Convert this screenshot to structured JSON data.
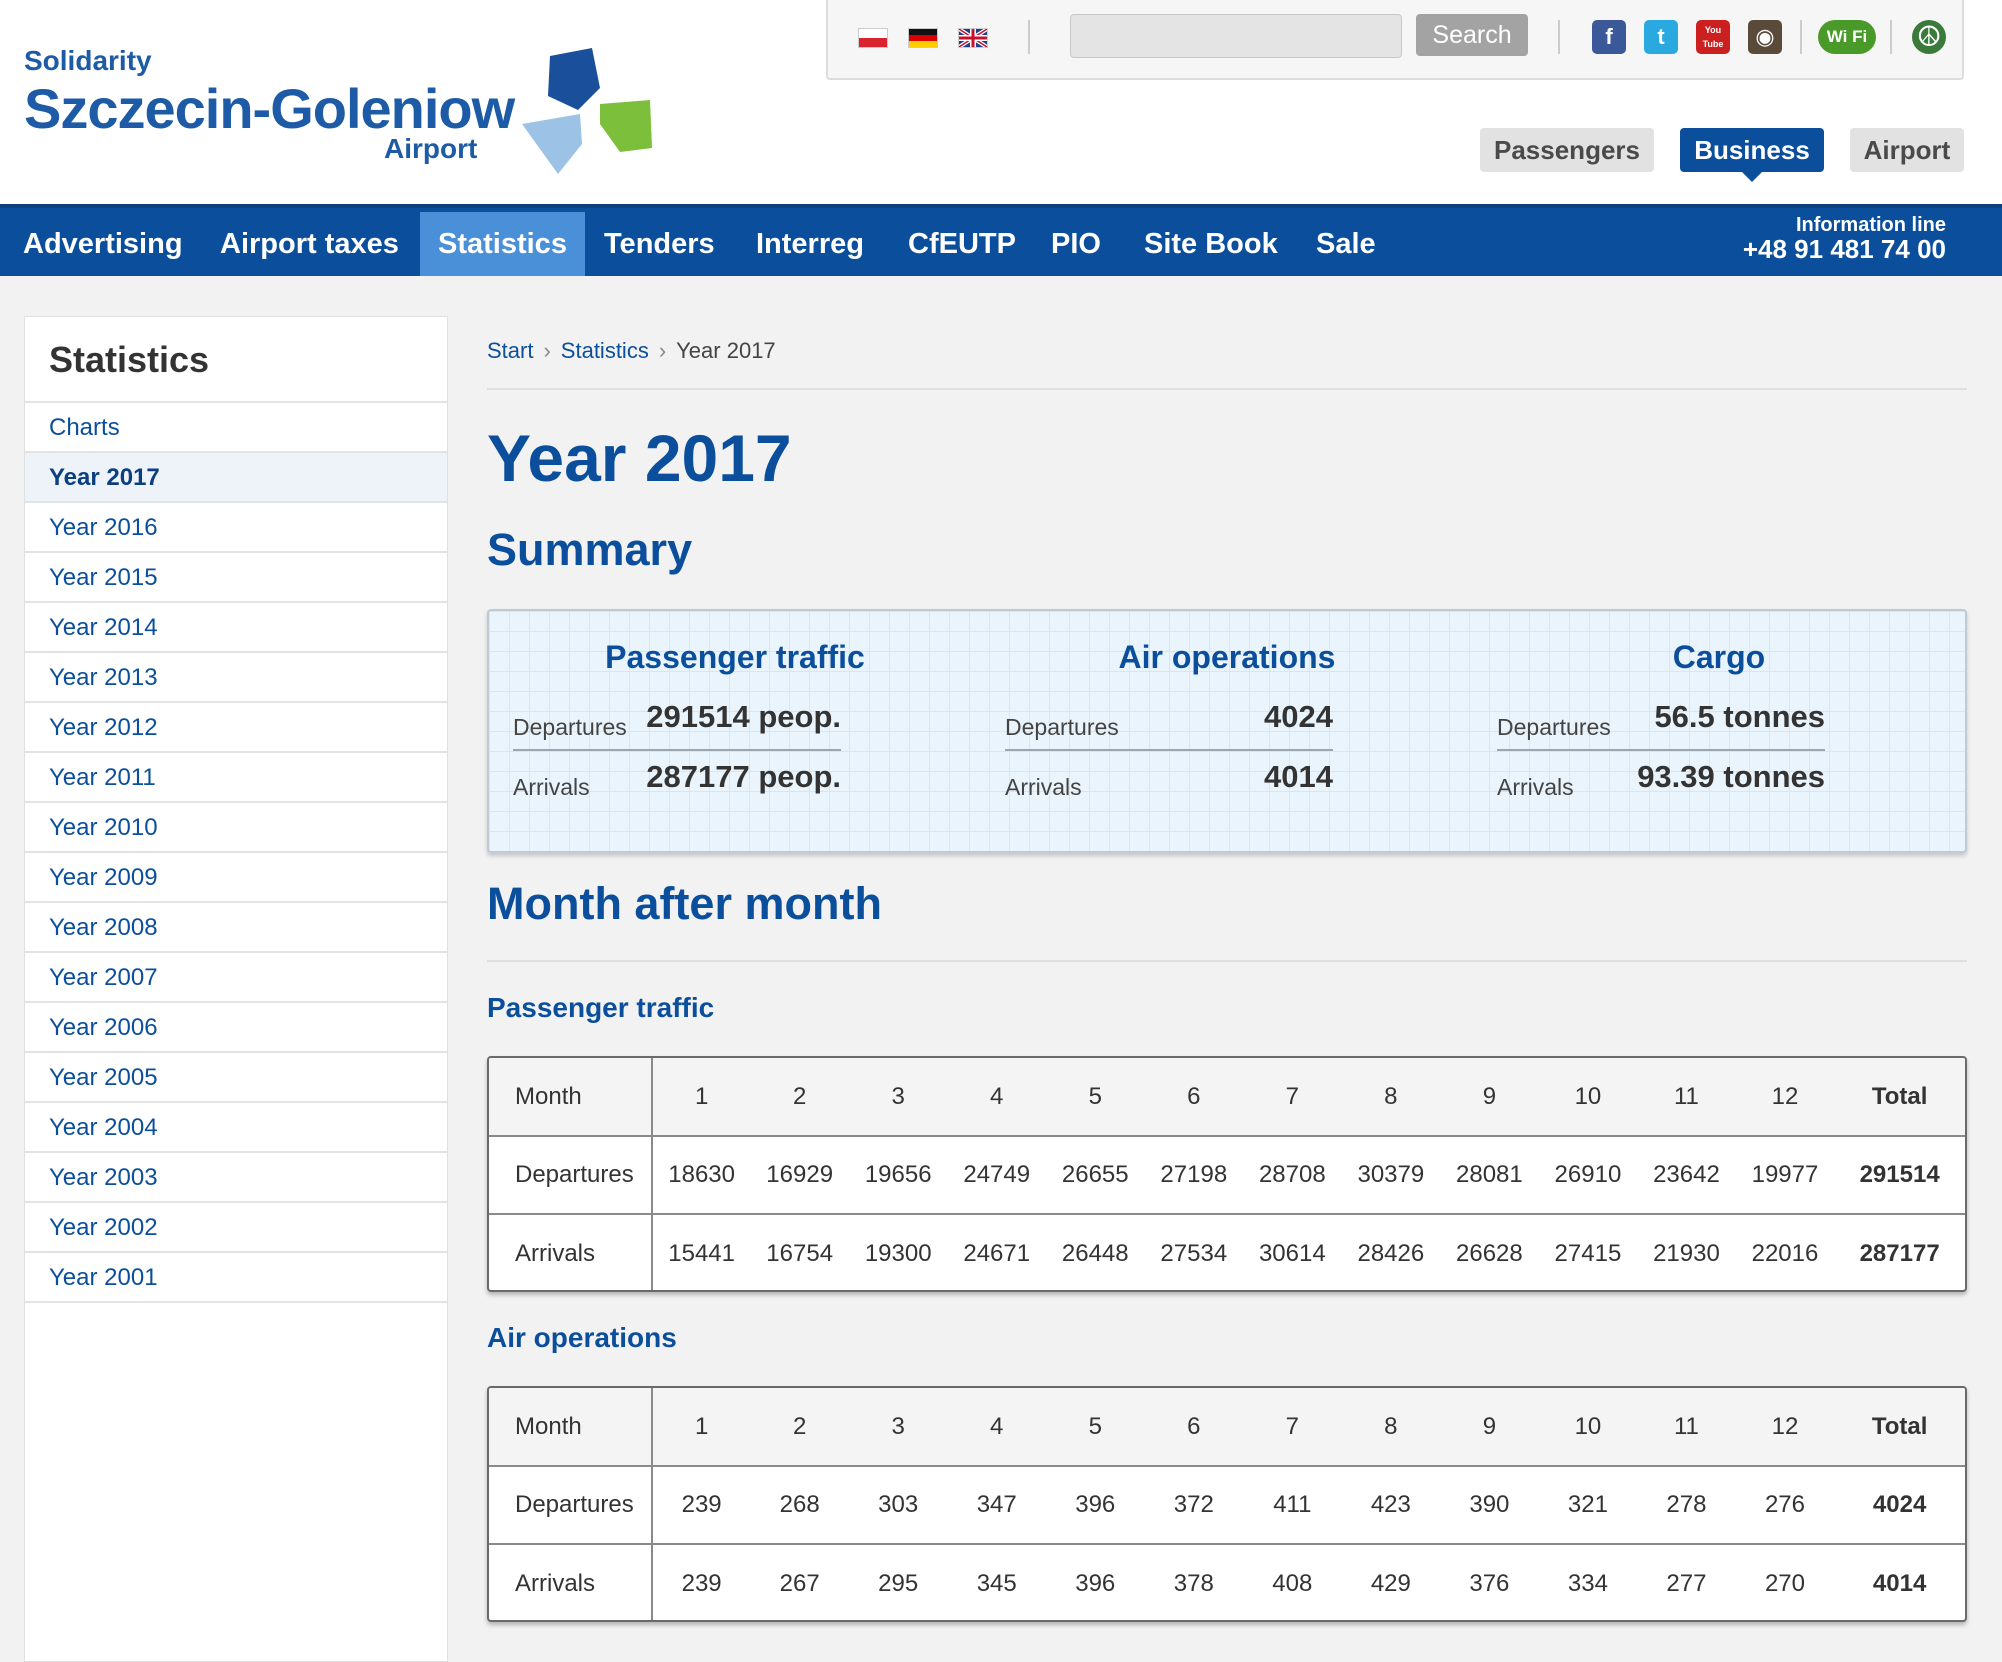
{
  "logo": {
    "sup": "Solidarity",
    "main": "Szczecin-Goleniow",
    "sub": "Airport"
  },
  "topbar": {
    "flags": [
      "flag-poland-icon",
      "flag-germany-icon",
      "flag-uk-icon"
    ],
    "search_placeholder": "",
    "search_label": "Search",
    "social": [
      {
        "name": "facebook-icon",
        "glyph": "f",
        "color": "#3b5998"
      },
      {
        "name": "twitter-icon",
        "glyph": "t",
        "color": "#2aa9e0"
      },
      {
        "name": "youtube-icon",
        "glyph": "You Tube",
        "color": "#cc1f1f"
      },
      {
        "name": "instagram-icon",
        "glyph": "◉",
        "color": "#5a4a3a"
      },
      {
        "name": "wifi-icon",
        "glyph": "Wi Fi",
        "color": "#4a9a2a"
      },
      {
        "name": "peace-icon",
        "glyph": "☮",
        "color": "#3a7a3a"
      }
    ]
  },
  "audience_tabs": [
    {
      "label": "Passengers",
      "active": false
    },
    {
      "label": "Business",
      "active": true
    },
    {
      "label": "Airport",
      "active": false
    }
  ],
  "nav": {
    "items": [
      "Advertising",
      "Airport taxes",
      "Statistics",
      "Tenders",
      "Interreg",
      "CfEUTP",
      "PIO",
      "Site Book",
      "Sale"
    ],
    "active": "Statistics",
    "info_label": "Information line",
    "info_phone": "+48 91 481 74 00"
  },
  "sidebar": {
    "title": "Statistics",
    "items": [
      "Charts",
      "Year 2017",
      "Year 2016",
      "Year 2015",
      "Year 2014",
      "Year 2013",
      "Year 2012",
      "Year 2011",
      "Year 2010",
      "Year 2009",
      "Year 2008",
      "Year 2007",
      "Year 2006",
      "Year 2005",
      "Year 2004",
      "Year 2003",
      "Year 2002",
      "Year 2001"
    ],
    "active": "Year 2017"
  },
  "breadcrumb": {
    "items": [
      "Start",
      "Statistics"
    ],
    "current": "Year 2017"
  },
  "page_title": "Year 2017",
  "summary_heading": "Summary",
  "summary": [
    {
      "title": "Passenger traffic",
      "departures_label": "Departures",
      "departures": "291514 peop.",
      "arrivals_label": "Arrivals",
      "arrivals": "287177 peop."
    },
    {
      "title": "Air operations",
      "departures_label": "Departures",
      "departures": "4024",
      "arrivals_label": "Arrivals",
      "arrivals": "4014"
    },
    {
      "title": "Cargo",
      "departures_label": "Departures",
      "departures": "56.5 tonnes",
      "arrivals_label": "Arrivals",
      "arrivals": "93.39 tonnes"
    }
  ],
  "monthly_heading": "Month after month",
  "tables": [
    {
      "title": "Passenger traffic",
      "header": [
        "Month",
        "1",
        "2",
        "3",
        "4",
        "5",
        "6",
        "7",
        "8",
        "9",
        "10",
        "11",
        "12",
        "Total"
      ],
      "rows": [
        [
          "Departures",
          "18630",
          "16929",
          "19656",
          "24749",
          "26655",
          "27198",
          "28708",
          "30379",
          "28081",
          "26910",
          "23642",
          "19977",
          "291514"
        ],
        [
          "Arrivals",
          "15441",
          "16754",
          "19300",
          "24671",
          "26448",
          "27534",
          "30614",
          "28426",
          "26628",
          "27415",
          "21930",
          "22016",
          "287177"
        ]
      ]
    },
    {
      "title": "Air operations",
      "header": [
        "Month",
        "1",
        "2",
        "3",
        "4",
        "5",
        "6",
        "7",
        "8",
        "9",
        "10",
        "11",
        "12",
        "Total"
      ],
      "rows": [
        [
          "Departures",
          "239",
          "268",
          "303",
          "347",
          "396",
          "372",
          "411",
          "423",
          "390",
          "321",
          "278",
          "276",
          "4024"
        ],
        [
          "Arrivals",
          "239",
          "267",
          "295",
          "345",
          "396",
          "378",
          "408",
          "429",
          "376",
          "334",
          "277",
          "270",
          "4014"
        ]
      ]
    }
  ]
}
